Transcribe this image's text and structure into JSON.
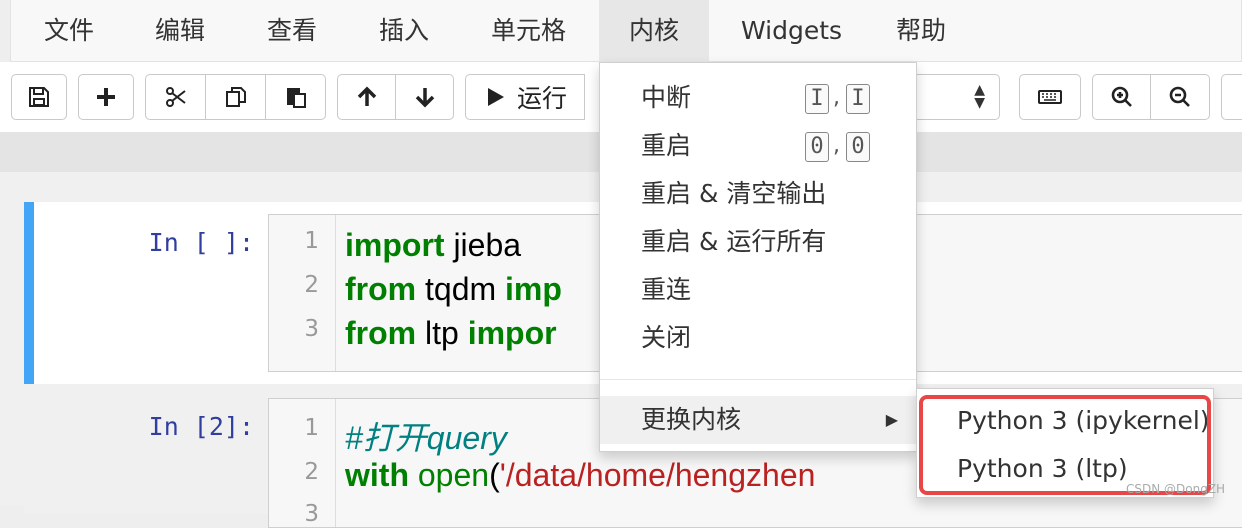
{
  "menubar": {
    "items": [
      {
        "label": "文件"
      },
      {
        "label": "编辑"
      },
      {
        "label": "查看"
      },
      {
        "label": "插入"
      },
      {
        "label": "单元格"
      },
      {
        "label": "内核"
      },
      {
        "label": "Widgets"
      },
      {
        "label": "帮助"
      }
    ],
    "active_index": 5
  },
  "toolbar": {
    "run_label": "运行",
    "icons": [
      "save-icon",
      "plus-icon",
      "scissors-icon",
      "copy-icon",
      "paste-icon",
      "arrow-up-icon",
      "arrow-down-icon",
      "play-icon",
      "keyboard-icon",
      "zoom-in-icon",
      "zoom-out-icon"
    ]
  },
  "cells": [
    {
      "prompt": "In [ ]:",
      "lines": [
        {
          "no": "1",
          "parts": [
            {
              "t": "import",
              "c": "kw"
            },
            {
              "t": " jieba",
              "c": ""
            }
          ]
        },
        {
          "no": "2",
          "parts": [
            {
              "t": "from",
              "c": "kw"
            },
            {
              "t": " tqdm ",
              "c": ""
            },
            {
              "t": "imp",
              "c": "kw"
            }
          ]
        },
        {
          "no": "3",
          "parts": [
            {
              "t": "from",
              "c": "kw"
            },
            {
              "t": " ltp ",
              "c": ""
            },
            {
              "t": "impor",
              "c": "kw"
            }
          ]
        }
      ]
    },
    {
      "prompt": "In [2]:",
      "lines": [
        {
          "no": "1",
          "parts": [
            {
              "t": "#打开query",
              "c": "cm"
            }
          ]
        },
        {
          "no": "2",
          "parts": [
            {
              "t": "with",
              "c": "kw"
            },
            {
              "t": " ",
              "c": ""
            },
            {
              "t": "open",
              "c": "bi"
            },
            {
              "t": "(",
              "c": ""
            },
            {
              "t": "'/data/home/hengzhen",
              "c": "str"
            }
          ]
        },
        {
          "no": "3",
          "parts": []
        }
      ]
    }
  ],
  "kernel_menu": {
    "items": [
      {
        "label": "中断",
        "shortcut": [
          "I",
          "I"
        ]
      },
      {
        "label": "重启",
        "shortcut": [
          "0",
          "0"
        ]
      },
      {
        "label": "重启 & 清空输出"
      },
      {
        "label": "重启 & 运行所有"
      },
      {
        "label": "重连"
      },
      {
        "label": "关闭"
      }
    ],
    "change_kernel_label": "更换内核"
  },
  "kernel_submenu": {
    "items": [
      "Python 3 (ipykernel)",
      "Python 3 (ltp)"
    ],
    "highlight_color": "#e84747"
  },
  "watermark": "CSDN @DongZH",
  "colors": {
    "selected_cell_border": "#42a5f5",
    "keyword": "#008000",
    "string": "#ba2121",
    "comment": "#008080"
  }
}
